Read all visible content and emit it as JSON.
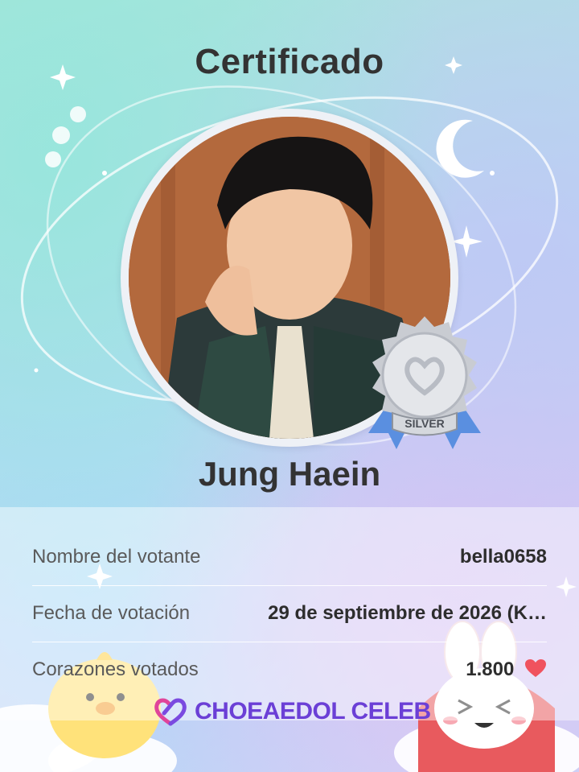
{
  "certificate": {
    "title": "Certificado",
    "celebrity_name": "Jung Haein",
    "medal_label": "SILVER"
  },
  "details": {
    "voter_label": "Nombre del votante",
    "voter_value": "bella0658",
    "date_label": "Fecha de votación",
    "date_value": "29 de septiembre de 2026 (K…",
    "hearts_label": "Corazones votados",
    "hearts_value": "1.800"
  },
  "brand": {
    "logo_text": "CHOEAEDOL CELEB",
    "accent_color": "#6b3fd6",
    "heart_color": "#f0525e"
  },
  "icons": [
    "sparkle-icon",
    "moon-icon",
    "silver-medal-icon",
    "heart-icon",
    "chick-mascot",
    "bunny-mascot"
  ]
}
